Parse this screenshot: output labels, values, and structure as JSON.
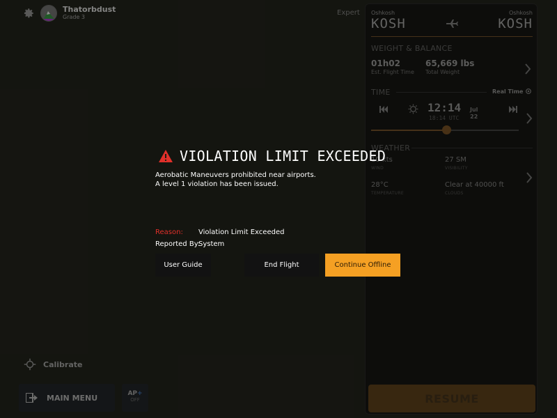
{
  "user": {
    "name": "Thatorbdust",
    "grade": "Grade 3"
  },
  "mode": "Expert",
  "route": {
    "from_city": "Oshkosh",
    "from_code": "KOSH",
    "to_city": "Oshkosh",
    "to_code": "KOSH"
  },
  "weight_balance": {
    "title": "WEIGHT & BALANCE",
    "flight_time": "01h02",
    "flight_time_label": "Est. Flight Time",
    "total_weight": "65,669 lbs",
    "total_weight_label": "Total Weight"
  },
  "time": {
    "title": "TIME",
    "real_time_label": "Real Time",
    "local": "12:14",
    "utc": "18:14 UTC",
    "month": "Jul",
    "day": "22",
    "slider_fraction": 0.51
  },
  "weather": {
    "title": "WEATHER",
    "wind": "10 kts",
    "wind_label": "WIND",
    "visibility": "27 SM",
    "visibility_label": "VISIBILITY",
    "temperature": "28°C",
    "temperature_label": "TEMPERATURE",
    "clouds": "Clear at 40000 ft",
    "clouds_label": "CLOUDS"
  },
  "resume_label": "RESUME",
  "alert": {
    "title": "VIOLATION LIMIT EXCEEDED",
    "line1": "Aerobatic Maneuvers prohibited near airports.",
    "line2": "A level 1 violation has been issued.",
    "reason_label": "Reason:",
    "reason_value": "Violation Limit Exceeded",
    "reported_label": "Reported By:",
    "reported_value": "System",
    "btn_guide": "User Guide",
    "btn_end": "End Flight",
    "btn_continue": "Continue Offline"
  },
  "calibrate_label": "Calibrate",
  "main_menu_label": "MAIN MENU",
  "ap": {
    "label": "AP",
    "plus": "+",
    "state": "OFF"
  },
  "colors": {
    "accent": "#f5a023",
    "danger": "#e0302a",
    "background": "#1b1c16"
  }
}
